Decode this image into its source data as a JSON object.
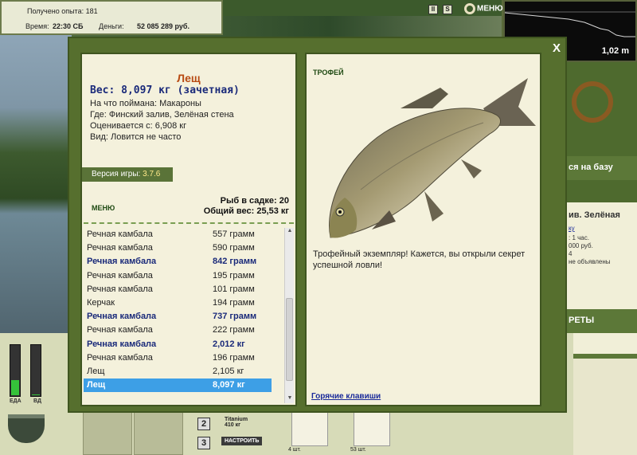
{
  "hud": {
    "xp_label": "Получено опыта: 181",
    "time_label": "Время:",
    "time_value": "22:30 СБ",
    "money_label": "Деньги:",
    "money_value": "52 085 289 руб.",
    "pause_icon": "II",
    "sound_icon": "S",
    "menu_label": "МЕНЮ",
    "depth_value": "1,02 m"
  },
  "right_panel": {
    "base_text": "ся на базу",
    "location_partial": "ив. Зелёная",
    "link_partial": "ку",
    "info_1": ": 1 час.",
    "info_2": "000 руб.",
    "info_3": "4",
    "info_4": "не объявлены",
    "secrets_text": "РЕТЫ"
  },
  "bottom": {
    "food_label": "ЕДА",
    "vodka_label": "ВД",
    "food_level": 0.3,
    "vodka_level": 0.02,
    "slot_2": "2",
    "slot_3": "3",
    "line_name": "Titanium",
    "line_weight": "410 кг",
    "set_button": "НАСТРОИТЬ",
    "inv_1_count": "4 шт.",
    "inv_2_count": "53 шт."
  },
  "modal": {
    "close_label": "X",
    "fish": {
      "name": "Лещ",
      "weight": "Вес: 8,097 кг (зачетная)",
      "bait": "На что поймана: Макароны",
      "place": "Где: Финский залив, Зелёная стена",
      "valued_from": "Оценивается с: 6,908 кг",
      "species": "Вид: Ловится не часто"
    },
    "version_label": "Версия игры:",
    "version_value": "3.7.6",
    "menu_label": "МЕНЮ",
    "cage_count": "Рыб в садке: 20",
    "cage_weight": "Общий вес: 25,53 кг",
    "catch": [
      {
        "name": "Речная камбала",
        "weight": "557 грамм",
        "style": ""
      },
      {
        "name": "Речная камбала",
        "weight": "590 грамм",
        "style": ""
      },
      {
        "name": "Речная камбала",
        "weight": "842 грамм",
        "style": "hl"
      },
      {
        "name": "Речная камбала",
        "weight": "195 грамм",
        "style": ""
      },
      {
        "name": "Речная камбала",
        "weight": "101 грамм",
        "style": ""
      },
      {
        "name": "Керчак",
        "weight": "194 грамм",
        "style": ""
      },
      {
        "name": "Речная камбала",
        "weight": "737 грамм",
        "style": "hl"
      },
      {
        "name": "Речная камбала",
        "weight": "222 грамм",
        "style": ""
      },
      {
        "name": "Речная камбала",
        "weight": "2,012 кг",
        "style": "hl"
      },
      {
        "name": "Речная камбала",
        "weight": "196 грамм",
        "style": ""
      },
      {
        "name": "Лещ",
        "weight": "2,105 кг",
        "style": ""
      },
      {
        "name": "Лещ",
        "weight": "8,097 кг",
        "style": "sel"
      }
    ],
    "trophy_label": "ТРОФЕЙ",
    "trophy_text": "Трофейный экземпляр! Кажется, вы открыли секрет успешной ловли!",
    "hotkeys": "Горячие клавиши"
  }
}
